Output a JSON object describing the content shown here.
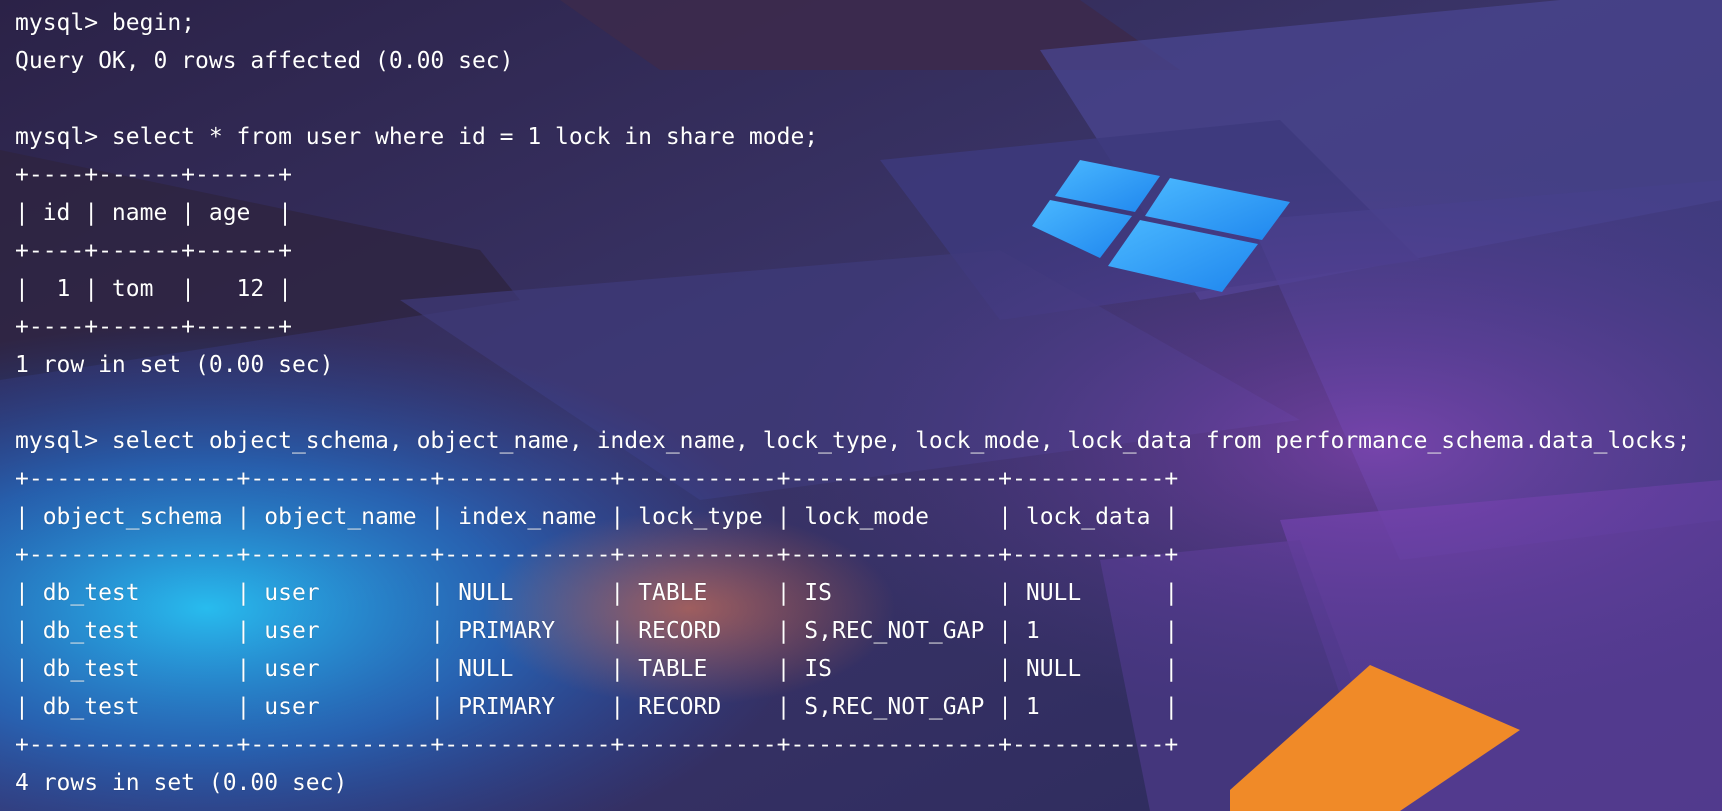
{
  "theme": {
    "text_color": "#ffffff",
    "accent_blue": "#2a9cf2",
    "accent_orange": "#f08a28",
    "background": "#2a2650"
  },
  "wallpaper": {
    "icon": "windows-logo-icon"
  },
  "terminal": {
    "lines": [
      "mysql> begin;",
      "Query OK, 0 rows affected (0.00 sec)",
      "",
      "mysql> select * from user where id = 1 lock in share mode;",
      "+----+------+------+",
      "| id | name | age  |",
      "+----+------+------+",
      "|  1 | tom  |   12 |",
      "+----+------+------+",
      "1 row in set (0.00 sec)",
      "",
      "mysql> select object_schema, object_name, index_name, lock_type, lock_mode, lock_data from performance_schema.data_locks;",
      "+---------------+-------------+------------+-----------+---------------+-----------+",
      "| object_schema | object_name | index_name | lock_type | lock_mode     | lock_data |",
      "+---------------+-------------+------------+-----------+---------------+-----------+",
      "| db_test       | user        | NULL       | TABLE     | IS            | NULL      |",
      "| db_test       | user        | PRIMARY    | RECORD    | S,REC_NOT_GAP | 1         |",
      "| db_test       | user        | NULL       | TABLE     | IS            | NULL      |",
      "| db_test       | user        | PRIMARY    | RECORD    | S,REC_NOT_GAP | 1         |",
      "+---------------+-------------+------------+-----------+---------------+-----------+",
      "4 rows in set (0.00 sec)"
    ]
  }
}
